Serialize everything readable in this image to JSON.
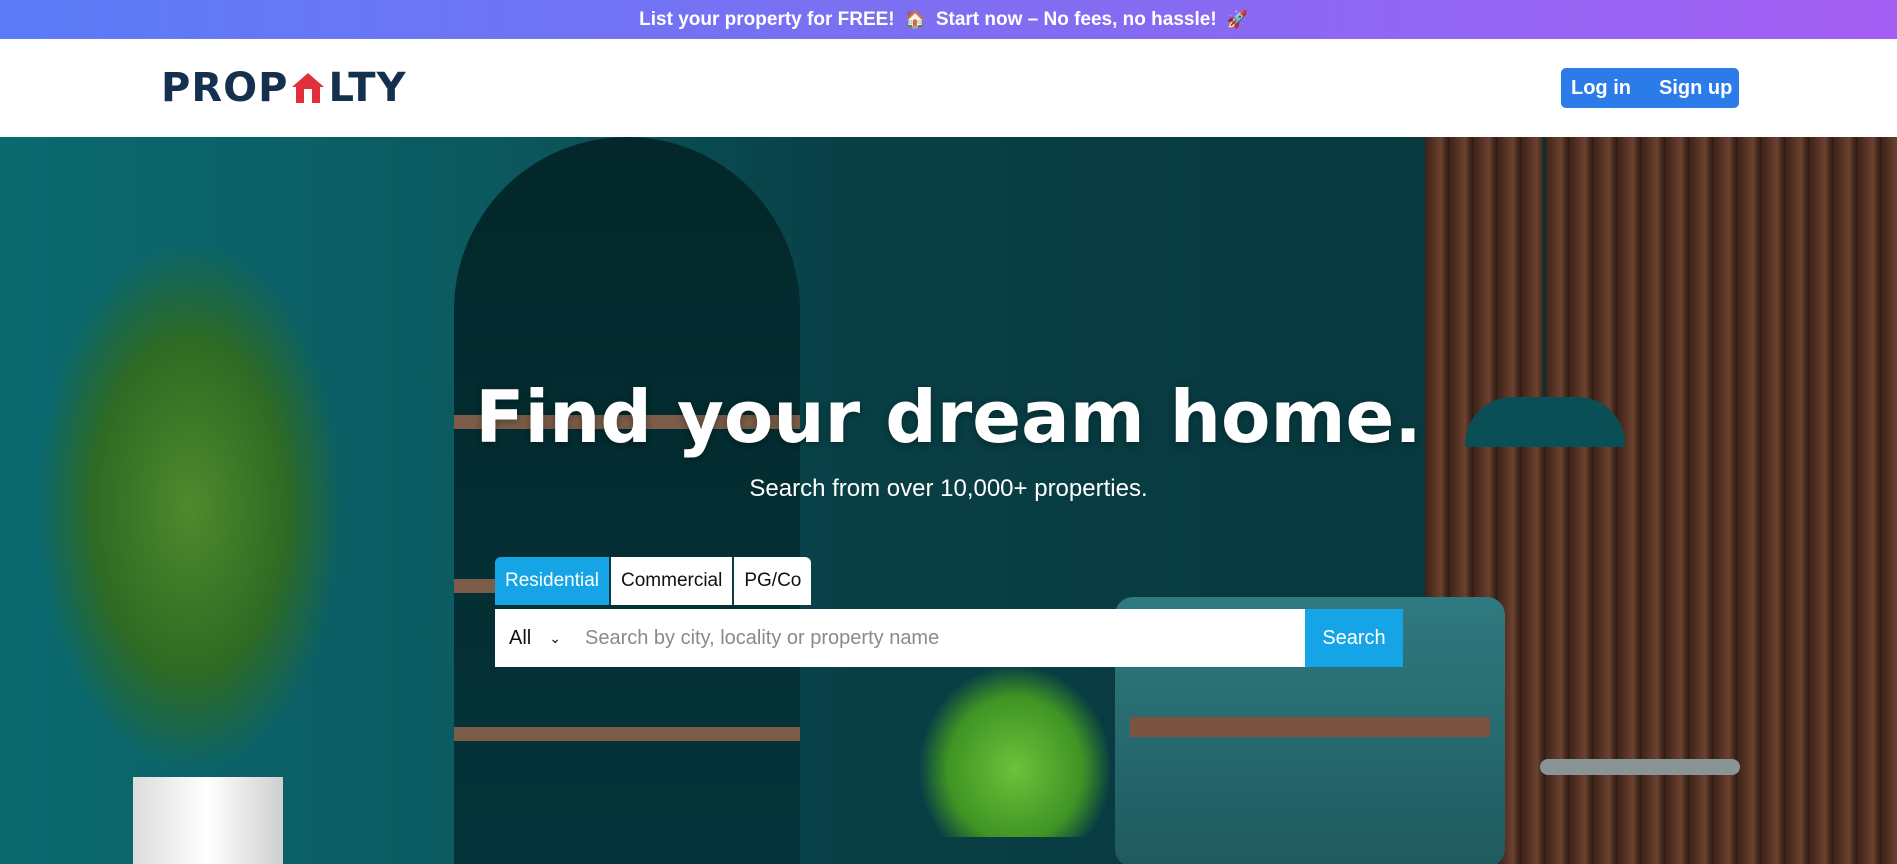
{
  "banner": {
    "text1": "List your property for FREE!",
    "emoji1": "🏠",
    "text2": "Start now – No fees, no hassle!",
    "emoji2": "🚀"
  },
  "logo": {
    "part1": "PROP",
    "part2": "LTY",
    "house_icon": "house-icon"
  },
  "auth": {
    "login": "Log in",
    "signup": "Sign up"
  },
  "hero": {
    "headline": "Find your dream home.",
    "subhead": "Search from over 10,000+ properties."
  },
  "tabs": [
    "Residential",
    "Commercial",
    "PG/Co"
  ],
  "search": {
    "category": "All",
    "placeholder": "Search by city, locality or property name",
    "button": "Search"
  },
  "colors": {
    "accent": "#15a4e6",
    "brand": "#14304e",
    "brand_house": "#e0313b",
    "auth_bg": "#2b7ce8"
  }
}
